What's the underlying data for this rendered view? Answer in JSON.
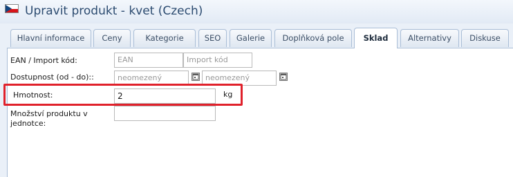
{
  "header": {
    "title": "Upravit produkt - kvet (Czech)",
    "flag_icon": "czech-flag-icon"
  },
  "tabs": [
    {
      "label": "Hlavní informace",
      "active": false
    },
    {
      "label": "Ceny",
      "active": false
    },
    {
      "label": "Kategorie",
      "active": false
    },
    {
      "label": "SEO",
      "active": false
    },
    {
      "label": "Galerie",
      "active": false
    },
    {
      "label": "Doplňková pole",
      "active": false
    },
    {
      "label": "Sklad",
      "active": true
    },
    {
      "label": "Alternativy",
      "active": false
    },
    {
      "label": "Diskuse",
      "active": false
    }
  ],
  "form": {
    "ean": {
      "label": "EAN / Import kód:",
      "ean_placeholder": "EAN",
      "import_placeholder": "Import kód"
    },
    "availability": {
      "label": "Dostupnost (od - do)::",
      "from_placeholder": "neomezený",
      "to_placeholder": "neomezený",
      "calendar_icon": "calendar-icon"
    },
    "weight": {
      "label": "Hmotnost:",
      "value": "2",
      "unit": "kg"
    },
    "quantity": {
      "label": "Množství produktu v jednotce:",
      "value": ""
    }
  },
  "colors": {
    "title": "#2c4b70",
    "highlight": "#e0212b",
    "tab_border": "#a9bdd6"
  }
}
